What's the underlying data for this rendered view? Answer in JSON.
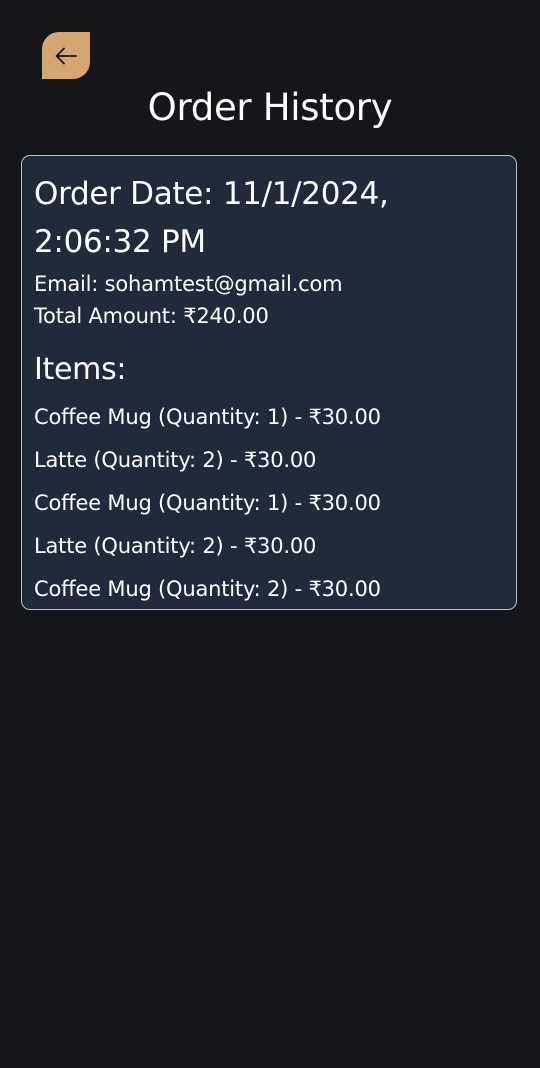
{
  "header": {
    "back_icon": "arrow-left-icon",
    "back_accent": "#d5a572",
    "title": "Order History"
  },
  "order": {
    "date_line_1": "Order Date: 11/1/2024,",
    "date_line_2": "2:06:32 PM",
    "email": "Email: sohamtest@gmail.com",
    "total": "Total Amount: ₹240.00",
    "items_heading": "Items:",
    "items": [
      {
        "text": "Coffee Mug (Quantity: 1) - ₹30.00"
      },
      {
        "text": "Latte (Quantity: 2) - ₹30.00"
      },
      {
        "text": "Coffee Mug (Quantity: 1) - ₹30.00"
      },
      {
        "text": "Latte (Quantity: 2) - ₹30.00"
      },
      {
        "text": "Coffee Mug (Quantity: 2) - ₹30.00"
      }
    ]
  },
  "colors": {
    "background": "#14161b",
    "card": "#212a3a",
    "card_border": "#b8bfca",
    "text": "#ffffff"
  }
}
